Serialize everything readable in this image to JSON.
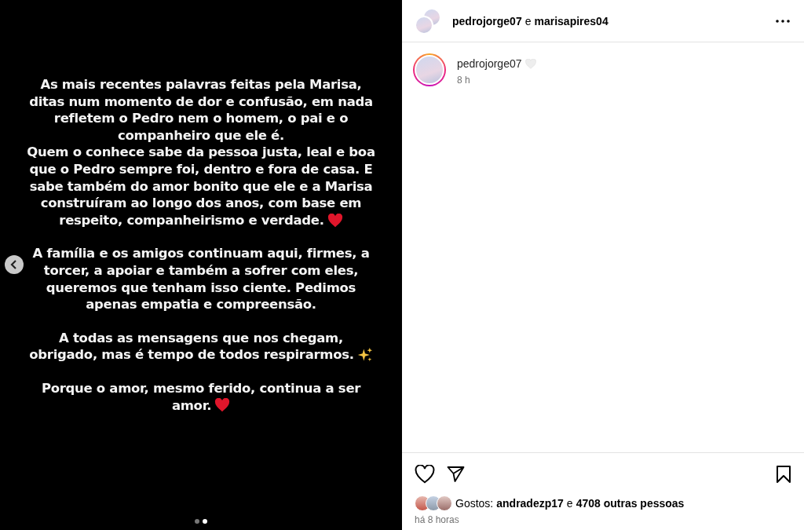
{
  "slide": {
    "blocks": [
      {
        "kind": "heart",
        "lines": [
          "As mais recentes palavras feitas pela Marisa,",
          "ditas num momento de dor e confusão, em nada",
          "refletem o Pedro nem o homem, o pai e o",
          "companheiro que ele é.",
          "Quem o conhece sabe da pessoa justa, leal e boa",
          "que o Pedro sempre foi, dentro e fora de casa. E",
          "sabe também do amor bonito que ele e a Marisa",
          "construíram ao longo dos anos, com base em",
          "respeito, companheirismo e verdade."
        ]
      },
      {
        "kind": "plain",
        "lines": [
          "A família e os amigos continuam aqui, firmes, a",
          "torcer, a apoiar e também a sofrer com eles,",
          "queremos que tenham isso ciente. Pedimos",
          "apenas empatia e compreensão."
        ]
      },
      {
        "kind": "sparkle",
        "lines": [
          "A todas as mensagens que nos chegam,",
          "obrigado, mas é tempo de todos respirarmos."
        ]
      },
      {
        "kind": "heart",
        "lines": [
          "Porque o amor, mesmo ferido, continua a ser",
          "amor."
        ]
      }
    ],
    "dots": [
      {
        "selected": false
      },
      {
        "selected": true
      }
    ]
  },
  "header": {
    "user": "pedrojorge07",
    "joiner": "e",
    "collaborator": "marisapires04"
  },
  "caption": {
    "user": "pedrojorge07",
    "time": "8 h"
  },
  "likes": {
    "prefix": "Gostos:",
    "user": "andradezp17",
    "joiner": "e",
    "others": "4708 outras pessoas"
  },
  "posted": "há 8 horas"
}
